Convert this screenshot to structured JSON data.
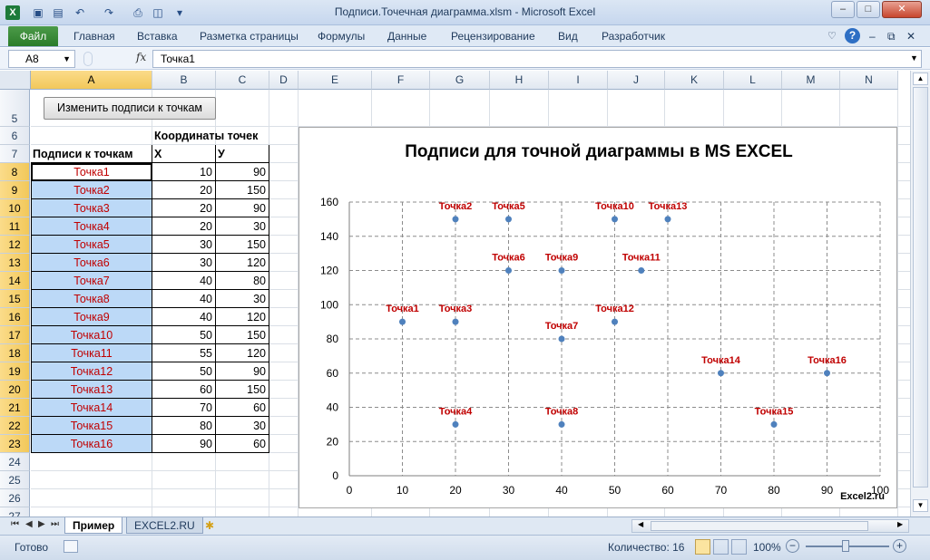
{
  "window": {
    "title": "Подписи.Точечная диаграмма.xlsm  -  Microsoft Excel",
    "app_icon": "excel-icon"
  },
  "ribbon": {
    "file_tab": "Файл",
    "tabs": [
      "Главная",
      "Вставка",
      "Разметка страницы",
      "Формулы",
      "Данные",
      "Рецензирование",
      "Вид",
      "Разработчик"
    ]
  },
  "formula_bar": {
    "name_box": "A8",
    "fx_label": "fx",
    "formula": "Точка1"
  },
  "sheet": {
    "columns": [
      "A",
      "B",
      "C",
      "D",
      "E",
      "F",
      "G",
      "H",
      "I",
      "J",
      "K",
      "L",
      "M",
      "N"
    ],
    "rows": [
      "5",
      "6",
      "7",
      "8",
      "9",
      "10",
      "11",
      "12",
      "13",
      "14",
      "15",
      "16",
      "17",
      "18",
      "19",
      "20",
      "21",
      "22",
      "23",
      "24",
      "25",
      "26",
      "27"
    ],
    "button_label": "Изменить подписи к точкам",
    "header_coords": "Координаты точек",
    "header_labels": "Подписи к точкам",
    "header_x": "Х",
    "header_y": "У",
    "table": [
      {
        "label": "Точка1",
        "x": "10",
        "y": "90"
      },
      {
        "label": "Точка2",
        "x": "20",
        "y": "150"
      },
      {
        "label": "Точка3",
        "x": "20",
        "y": "90"
      },
      {
        "label": "Точка4",
        "x": "20",
        "y": "30"
      },
      {
        "label": "Точка5",
        "x": "30",
        "y": "150"
      },
      {
        "label": "Точка6",
        "x": "30",
        "y": "120"
      },
      {
        "label": "Точка7",
        "x": "40",
        "y": "80"
      },
      {
        "label": "Точка8",
        "x": "40",
        "y": "30"
      },
      {
        "label": "Точка9",
        "x": "40",
        "y": "120"
      },
      {
        "label": "Точка10",
        "x": "50",
        "y": "150"
      },
      {
        "label": "Точка11",
        "x": "55",
        "y": "120"
      },
      {
        "label": "Точка12",
        "x": "50",
        "y": "90"
      },
      {
        "label": "Точка13",
        "x": "60",
        "y": "150"
      },
      {
        "label": "Точка14",
        "x": "70",
        "y": "60"
      },
      {
        "label": "Точка15",
        "x": "80",
        "y": "30"
      },
      {
        "label": "Точка16",
        "x": "90",
        "y": "60"
      }
    ]
  },
  "chart_data": {
    "type": "scatter",
    "title": "Подписи для точной диаграммы в MS EXCEL",
    "watermark": "Excel2.ru",
    "xlim": [
      0,
      100
    ],
    "ylim": [
      0,
      160
    ],
    "xticks": [
      0,
      10,
      20,
      30,
      40,
      50,
      60,
      70,
      80,
      90,
      100
    ],
    "yticks": [
      0,
      20,
      40,
      60,
      80,
      100,
      120,
      140,
      160
    ],
    "grid": true,
    "marker_color": "#4f81bd",
    "label_color": "#c00000",
    "points": [
      {
        "label": "Точка1",
        "x": 10,
        "y": 90
      },
      {
        "label": "Точка2",
        "x": 20,
        "y": 150
      },
      {
        "label": "Точка3",
        "x": 20,
        "y": 90
      },
      {
        "label": "Точка4",
        "x": 20,
        "y": 30
      },
      {
        "label": "Точка5",
        "x": 30,
        "y": 150
      },
      {
        "label": "Точка6",
        "x": 30,
        "y": 120
      },
      {
        "label": "Точка7",
        "x": 40,
        "y": 80
      },
      {
        "label": "Точка8",
        "x": 40,
        "y": 30
      },
      {
        "label": "Точка9",
        "x": 40,
        "y": 120
      },
      {
        "label": "Точка10",
        "x": 50,
        "y": 150
      },
      {
        "label": "Точка11",
        "x": 55,
        "y": 120
      },
      {
        "label": "Точка12",
        "x": 50,
        "y": 90
      },
      {
        "label": "Точка13",
        "x": 60,
        "y": 150
      },
      {
        "label": "Точка14",
        "x": 70,
        "y": 60
      },
      {
        "label": "Точка15",
        "x": 80,
        "y": 30
      },
      {
        "label": "Точка16",
        "x": 90,
        "y": 60
      }
    ]
  },
  "sheet_tabs": {
    "tabs": [
      "Пример",
      "EXCEL2.RU"
    ],
    "active": "Пример"
  },
  "status_bar": {
    "ready": "Готово",
    "count": "Количество: 16",
    "zoom": "100%"
  }
}
